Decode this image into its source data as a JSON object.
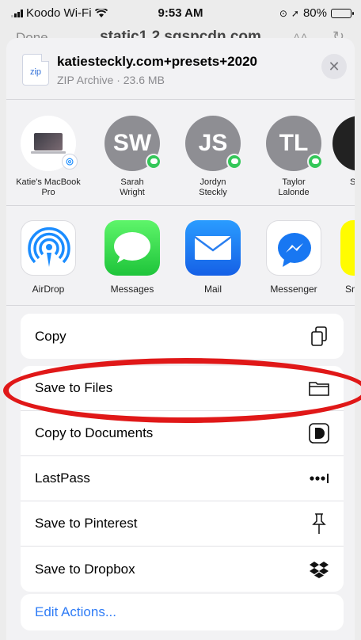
{
  "status_bar": {
    "carrier": "Koodo Wi-Fi",
    "time": "9:53 AM",
    "battery": "80%",
    "battery_level": 0.8
  },
  "browser": {
    "done_label": "Done",
    "url": "static1.2.sqspcdn.com",
    "aa_label": "AA"
  },
  "file": {
    "icon_label": "zip",
    "name": "katiesteckly.com+presets+2020",
    "meta": "ZIP Archive · 23.6 MB"
  },
  "people": [
    {
      "name": "Katie's MacBook Pro",
      "initials": "",
      "kind": "mac"
    },
    {
      "name": "Sarah Wright",
      "initials": "SW",
      "kind": "person"
    },
    {
      "name": "Jordyn Steckly",
      "initials": "JS",
      "kind": "person"
    },
    {
      "name": "Taylor Lalonde",
      "initials": "TL",
      "kind": "person"
    },
    {
      "name": "S",
      "initials": "",
      "kind": "photo"
    }
  ],
  "apps": [
    {
      "label": "AirDrop",
      "icon": "airdrop-icon"
    },
    {
      "label": "Messages",
      "icon": "messages-icon"
    },
    {
      "label": "Mail",
      "icon": "mail-icon"
    },
    {
      "label": "Messenger",
      "icon": "messenger-icon"
    },
    {
      "label": "Sn",
      "icon": "snapchat-icon"
    }
  ],
  "actions": {
    "copy": {
      "label": "Copy",
      "icon": "copy-icon"
    },
    "list": [
      {
        "label": "Save to Files",
        "icon": "folder-icon"
      },
      {
        "label": "Copy to Documents",
        "icon": "documents-icon"
      },
      {
        "label": "LastPass",
        "icon": "lastpass-icon"
      },
      {
        "label": "Save to Pinterest",
        "icon": "pin-icon"
      },
      {
        "label": "Save to Dropbox",
        "icon": "dropbox-icon"
      }
    ],
    "edit_label": "Edit Actions..."
  },
  "colors": {
    "accent": "#2f7cf6",
    "highlight": "#e01818",
    "messages_green": "#34c759"
  }
}
